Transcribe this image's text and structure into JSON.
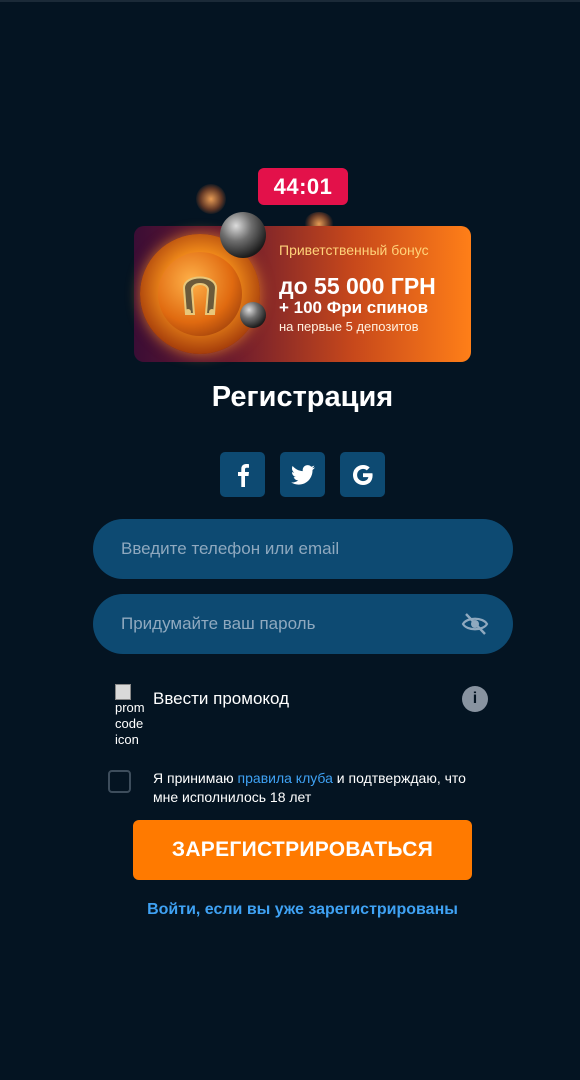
{
  "timer": "44:01",
  "bonus": {
    "label": "Приветственный бонус",
    "amount": "до 55 000 ГРН",
    "spins": "+ 100 Фри спинов",
    "note": "на первые 5 депозитов"
  },
  "title": "Регистрация",
  "social": [
    {
      "name": "facebook-icon",
      "glyph": "f"
    },
    {
      "name": "twitter-icon"
    },
    {
      "name": "google-icon",
      "glyph": "G"
    }
  ],
  "form": {
    "login_placeholder": "Введите телефон или email",
    "password_placeholder": "Придумайте ваш пароль"
  },
  "promo": {
    "icon_alt": "promo code icon",
    "label": "Ввести промокод",
    "info": "i"
  },
  "terms": {
    "prefix": "Я принимаю ",
    "link": "правила клуба",
    "suffix": " и подтверждаю, что мне исполнилось 18 лет"
  },
  "register_button": "ЗАРЕГИСТРИРОВАТЬСЯ",
  "login_link": "Войти, если вы уже зарегистрированы",
  "colors": {
    "background": "#041422",
    "accent": "#ff7a00",
    "link": "#3fa2f4",
    "field": "#0d4a72",
    "timer": "#e3114a"
  }
}
